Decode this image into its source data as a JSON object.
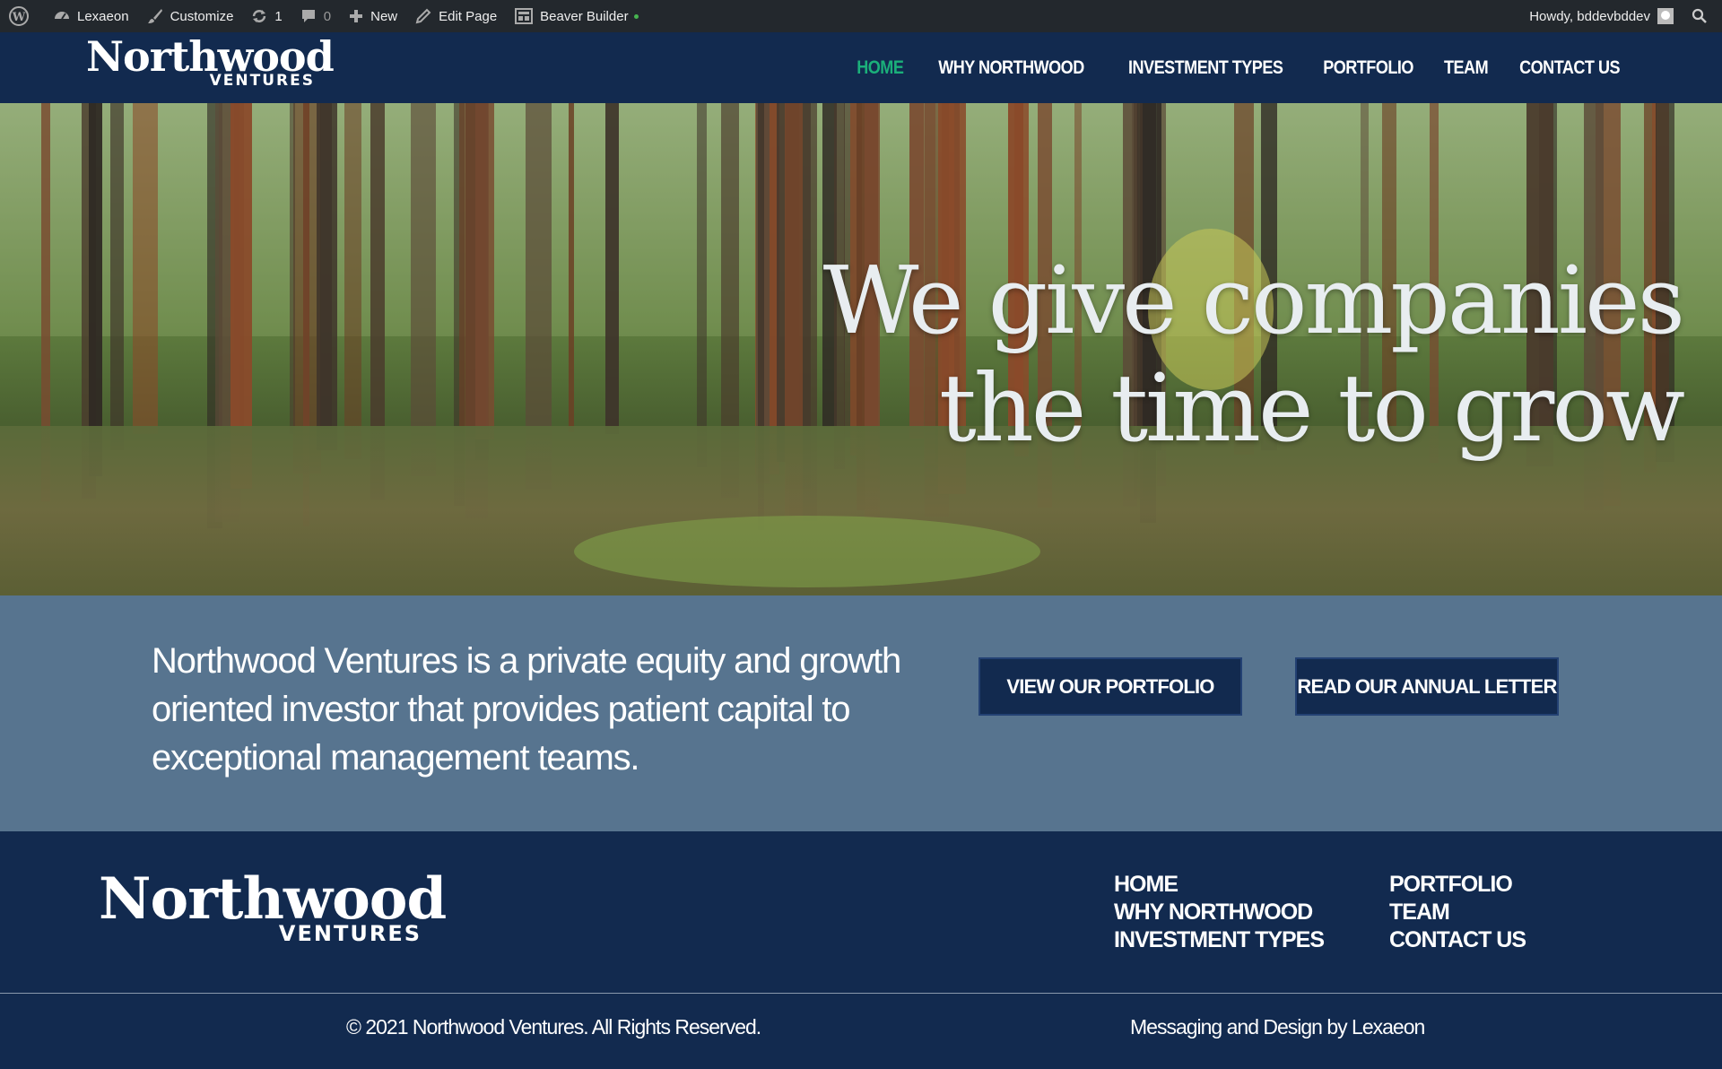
{
  "admin_bar": {
    "site_name": "Lexaeon",
    "customize": "Customize",
    "updates_count": "1",
    "comments_count": "0",
    "new": "New",
    "edit_page": "Edit Page",
    "beaver_builder": "Beaver Builder",
    "howdy": "Howdy, bddevbddev"
  },
  "header": {
    "logo_word": "Northwood",
    "logo_sub": "VENTURES",
    "nav": [
      {
        "label": "HOME",
        "active": true
      },
      {
        "label": "WHY NORTHWOOD",
        "active": false
      },
      {
        "label": "INVESTMENT TYPES",
        "active": false
      },
      {
        "label": "PORTFOLIO",
        "active": false
      },
      {
        "label": "TEAM",
        "active": false
      },
      {
        "label": "CONTACT US",
        "active": false
      }
    ]
  },
  "hero": {
    "line1": "We give companies",
    "line2": "the time to grow"
  },
  "intro": {
    "text": "Northwood Ventures is a private equity and growth oriented investor that provides patient capital to exceptional management teams.",
    "button_portfolio": "VIEW OUR PORTFOLIO",
    "button_letter": "READ OUR ANNUAL LETTER"
  },
  "footer": {
    "logo_word": "Northwood",
    "logo_sub": "VENTURES",
    "col1": [
      "HOME",
      "WHY NORTHWOOD",
      "INVESTMENT TYPES"
    ],
    "col2": [
      "PORTFOLIO",
      "TEAM",
      "CONTACT US"
    ],
    "copyright": "© 2021 Northwood Ventures. All Rights Reserved.",
    "credit": "Messaging and Design by Lexaeon"
  },
  "colors": {
    "navy": "#122a4f",
    "slate": "#57748f",
    "accent_green": "#1bb07a",
    "admin_bar": "#23282d"
  }
}
